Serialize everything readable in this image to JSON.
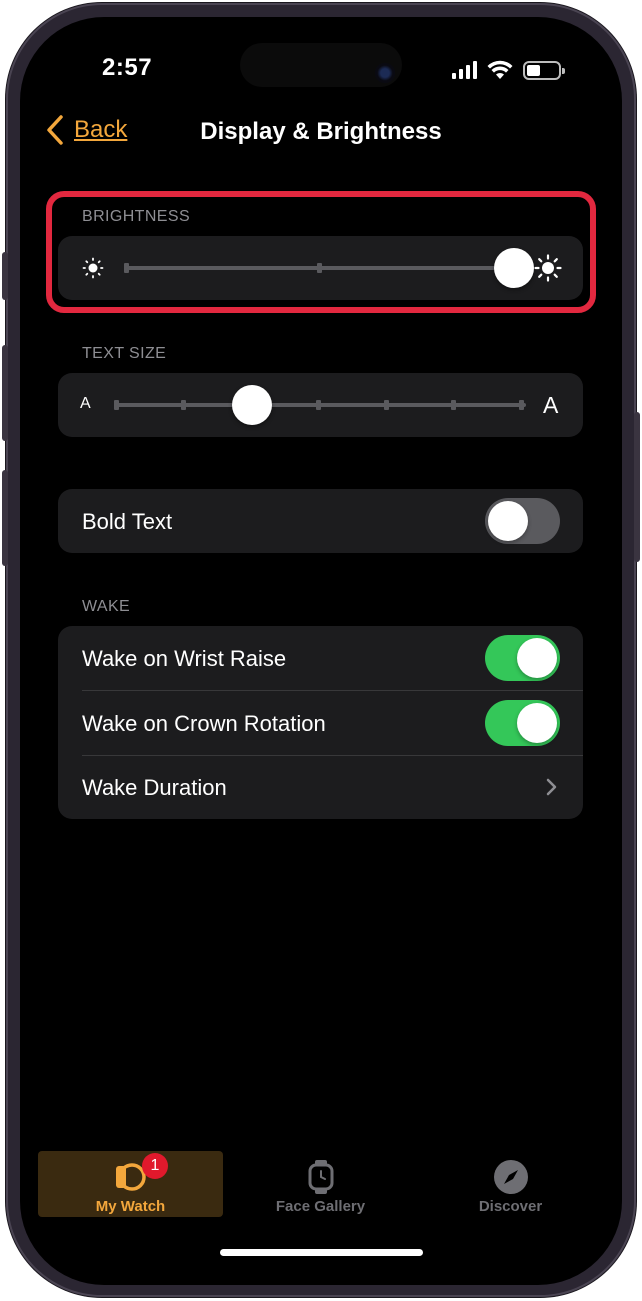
{
  "status_bar": {
    "time": "2:57"
  },
  "nav": {
    "back_label": "Back",
    "title": "Display & Brightness"
  },
  "brightness": {
    "header": "BRIGHTNESS",
    "level": 1.0
  },
  "text_size": {
    "header": "TEXT SIZE",
    "small_glyph": "A",
    "large_glyph": "A",
    "step": 2,
    "steps": 7
  },
  "bold_text": {
    "label": "Bold Text",
    "on": false
  },
  "wake": {
    "header": "WAKE",
    "wrist_raise": {
      "label": "Wake on Wrist Raise",
      "on": true
    },
    "crown_rotation": {
      "label": "Wake on Crown Rotation",
      "on": true
    },
    "duration": {
      "label": "Wake Duration"
    }
  },
  "tab_bar": {
    "my_watch": {
      "label": "My Watch",
      "badge": "1",
      "selected": true
    },
    "face_gallery": {
      "label": "Face Gallery"
    },
    "discover": {
      "label": "Discover"
    }
  },
  "colors": {
    "accent": "#f3a73c",
    "toggle_on": "#34c759",
    "toggle_off": "#5a5a5e",
    "highlight": "#e2283f",
    "card": "#1c1c1e",
    "tab_selected_bg": "#3a2a10",
    "tab_inactive": "#6e6e73"
  }
}
